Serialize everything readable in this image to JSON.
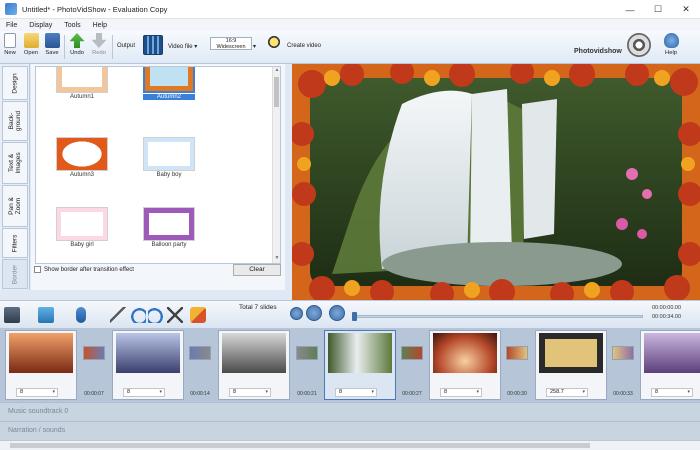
{
  "window": {
    "title": "Untitled* - PhotoVidShow - Evaluation Copy",
    "controls": [
      "—",
      "☐",
      "✕"
    ]
  },
  "menu": [
    "File",
    "Display",
    "Tools",
    "Help"
  ],
  "toolbar": {
    "new_label": "New",
    "open_label": "Open",
    "save_label": "Save",
    "undo_label": "Undo",
    "redo_label": "Redo",
    "output_label": "Output",
    "video_file_label": "Video file ▾",
    "aspect_value": "16:9 Widescreen",
    "create_video_label": "Create video",
    "brand": "Photovidshow",
    "help_label": "Help"
  },
  "side_tabs": [
    "Design",
    "Back-ground",
    "Text & Images",
    "Pan & Zoom",
    "Filters",
    "Border"
  ],
  "borders": {
    "items": [
      {
        "label": "Autumn1",
        "selected": false,
        "color": "#f2c69a"
      },
      {
        "label": "Autumn2",
        "selected": true,
        "color": "#e07a22"
      },
      {
        "label": "Autumn3",
        "selected": false,
        "color": "#e25a1a"
      },
      {
        "label": "Baby boy",
        "selected": false,
        "color": "#cfe4f7"
      },
      {
        "label": "Baby girl",
        "selected": false,
        "color": "#fbd8e6"
      },
      {
        "label": "Balloon party",
        "selected": false,
        "color": "#9e5ab8"
      }
    ],
    "show_border_label": "Show border after transition effect",
    "clear_label": "Clear"
  },
  "timeline": {
    "total_slides": "Total 7 slides",
    "time_top": "00:00:00.00",
    "time_bottom": "00:00:34.00",
    "slides": [
      {
        "duration": "8",
        "color": "#c4542c",
        "current": false
      },
      {
        "duration": "8",
        "color": "#6d7ab0",
        "current": false
      },
      {
        "duration": "8",
        "color": "#8a8a8a",
        "current": false
      },
      {
        "duration": "8",
        "color": "#5f7f54",
        "current": true
      },
      {
        "duration": "8",
        "color": "#b5482a",
        "current": false
      },
      {
        "duration": "258.7",
        "color": "#e2c37a",
        "current": false
      },
      {
        "duration": "8",
        "color": "#8e6fa8",
        "current": false
      }
    ],
    "transition_times": [
      "00:00:07",
      "00:00:14",
      "00:00:21",
      "00:00:27",
      "00:00:30",
      "00:00:33"
    ],
    "music_label": "Music soundtrack 0",
    "narration_label": "Narration / sounds"
  }
}
